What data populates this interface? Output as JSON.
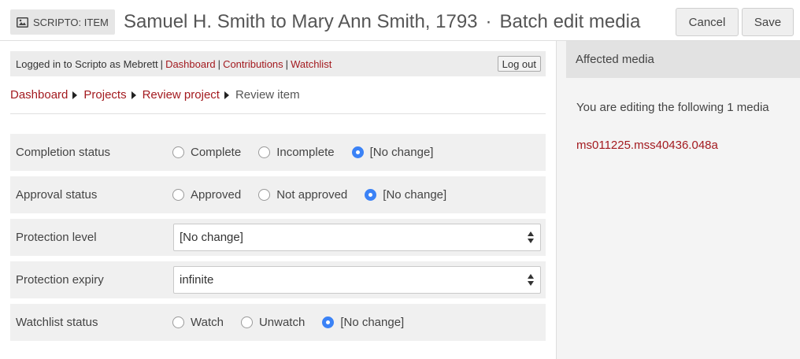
{
  "header": {
    "badge_label": "SCRIPTO: ITEM",
    "badge_icon": "image-icon",
    "title_main": "Samuel H. Smith to Mary Ann Smith, 1793",
    "title_separator": "·",
    "title_sub": "Batch edit media",
    "cancel_label": "Cancel",
    "save_label": "Save"
  },
  "userbar": {
    "logged_in_text": "Logged in to Scripto as Mebrett",
    "separator": "|",
    "links": [
      "Dashboard",
      "Contributions",
      "Watchlist"
    ],
    "logout_label": "Log out"
  },
  "breadcrumb": {
    "items": [
      "Dashboard",
      "Projects",
      "Review project"
    ],
    "current": "Review item"
  },
  "form": {
    "completion": {
      "label": "Completion status",
      "options": [
        "Complete",
        "Incomplete",
        "[No change]"
      ],
      "selected": "[No change]"
    },
    "approval": {
      "label": "Approval status",
      "options": [
        "Approved",
        "Not approved",
        "[No change]"
      ],
      "selected": "[No change]"
    },
    "protection_level": {
      "label": "Protection level",
      "value": "[No change]"
    },
    "protection_expiry": {
      "label": "Protection expiry",
      "value": "infinite"
    },
    "watchlist": {
      "label": "Watchlist status",
      "options": [
        "Watch",
        "Unwatch",
        "[No change]"
      ],
      "selected": "[No change]"
    }
  },
  "sidebar": {
    "heading": "Affected media",
    "text": "You are editing the following 1 media",
    "media": [
      "ms011225.mss40436.048a"
    ]
  },
  "colors": {
    "link": "#a31a1f",
    "radio_selected": "#3b82f6",
    "row_background": "#f0f0f0"
  }
}
